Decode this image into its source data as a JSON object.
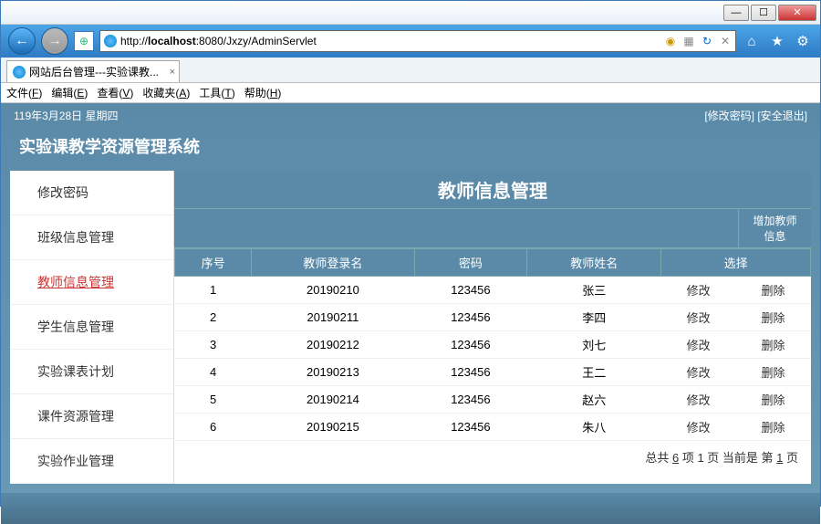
{
  "window": {
    "min": "—",
    "max": "☐",
    "close": "✕"
  },
  "nav": {
    "back": "←",
    "fwd": "→",
    "shield": "⊕"
  },
  "address": {
    "prefix": "http://",
    "host": "localhost",
    "port": ":8080",
    "path": "/Jxzy/AdminServlet"
  },
  "tab": {
    "title": "网站后台管理---实验课教...",
    "close": "×"
  },
  "menu": [
    {
      "label": "文件",
      "key": "F"
    },
    {
      "label": "编辑",
      "key": "E"
    },
    {
      "label": "查看",
      "key": "V"
    },
    {
      "label": "收藏夹",
      "key": "A"
    },
    {
      "label": "工具",
      "key": "T"
    },
    {
      "label": "帮助",
      "key": "H"
    }
  ],
  "app": {
    "date": "119年3月28日 星期四",
    "links": {
      "pwd": "[修改密码]",
      "exit": "[安全退出]"
    },
    "title": "实验课教学资源管理系统"
  },
  "sidebar": [
    {
      "label": "修改密码",
      "active": false
    },
    {
      "label": "班级信息管理",
      "active": false
    },
    {
      "label": "教师信息管理",
      "active": true
    },
    {
      "label": "学生信息管理",
      "active": false
    },
    {
      "label": "实验课表计划",
      "active": false
    },
    {
      "label": "课件资源管理",
      "active": false
    },
    {
      "label": "实验作业管理",
      "active": false
    }
  ],
  "panel": {
    "title": "教师信息管理",
    "add": "增加教师信息"
  },
  "columns": [
    "序号",
    "教师登录名",
    "密码",
    "教师姓名",
    "选择"
  ],
  "rows": [
    {
      "n": "1",
      "login": "20190210",
      "pwd": "123456",
      "name": "张三",
      "edit": "修改",
      "del": "删除"
    },
    {
      "n": "2",
      "login": "20190211",
      "pwd": "123456",
      "name": "李四",
      "edit": "修改",
      "del": "删除"
    },
    {
      "n": "3",
      "login": "20190212",
      "pwd": "123456",
      "name": "刘七",
      "edit": "修改",
      "del": "删除"
    },
    {
      "n": "4",
      "login": "20190213",
      "pwd": "123456",
      "name": "王二",
      "edit": "修改",
      "del": "删除"
    },
    {
      "n": "5",
      "login": "20190214",
      "pwd": "123456",
      "name": "赵六",
      "edit": "修改",
      "del": "删除"
    },
    {
      "n": "6",
      "login": "20190215",
      "pwd": "123456",
      "name": "朱八",
      "edit": "修改",
      "del": "删除"
    }
  ],
  "pager": {
    "p1": "总共 ",
    "c": "6",
    "p2": " 项 1 页  当前是 第 ",
    "cur": "1",
    "p3": " 页"
  }
}
